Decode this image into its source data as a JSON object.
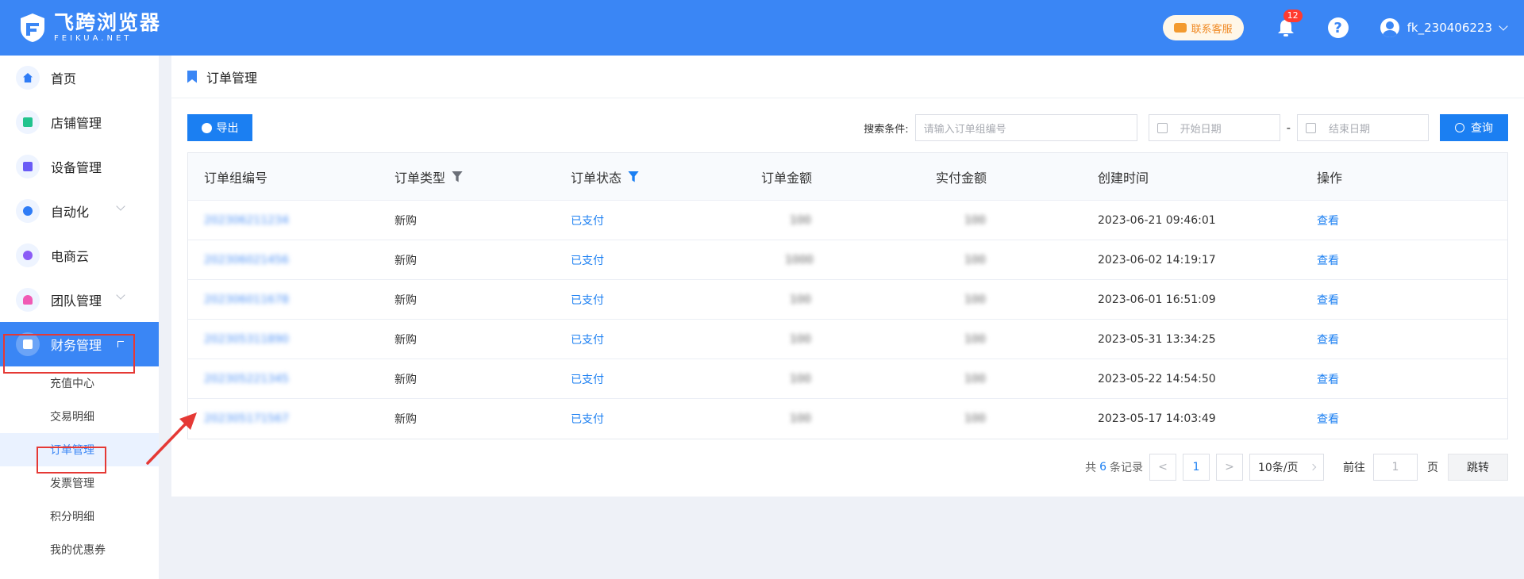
{
  "header": {
    "logo_name": "飞跨浏览器",
    "logo_sub": "FEIKUA.NET",
    "service_label": "联系客服",
    "notification_count": "12",
    "help_glyph": "?",
    "username": "fk_230406223"
  },
  "sidebar": {
    "items": [
      {
        "label": "首页",
        "icon": "home-icon",
        "color": "#2f7cf6"
      },
      {
        "label": "店铺管理",
        "icon": "store-icon",
        "color": "#22c38e"
      },
      {
        "label": "设备管理",
        "icon": "device-icon",
        "color": "#6a5cf6"
      },
      {
        "label": "自动化",
        "icon": "automation-icon",
        "color": "#2f7cf6"
      },
      {
        "label": "电商云",
        "icon": "cloud-icon",
        "color": "#8b5cf6"
      },
      {
        "label": "团队管理",
        "icon": "team-icon",
        "color": "#f05ab4"
      },
      {
        "label": "财务管理",
        "icon": "wallet-icon",
        "color": "#ffffff"
      }
    ],
    "sub_items": [
      "充值中心",
      "交易明细",
      "订单管理",
      "发票管理",
      "积分明细",
      "我的优惠券"
    ]
  },
  "page": {
    "breadcrumb": "订单管理",
    "export_label": "导出",
    "search_label": "搜索条件:",
    "order_placeholder": "请输入订单组编号",
    "start_date_placeholder": "开始日期",
    "end_date_placeholder": "结束日期",
    "date_separator": "-",
    "query_label": "查询"
  },
  "table": {
    "columns": [
      "订单组编号",
      "订单类型",
      "订单状态",
      "订单金额",
      "实付金额",
      "创建时间",
      "操作"
    ],
    "rows": [
      {
        "id": "202306211234",
        "type": "新购",
        "status": "已支付",
        "amount": "100",
        "paid": "100",
        "created": "2023-06-21 09:46:01",
        "action": "查看"
      },
      {
        "id": "202306021456",
        "type": "新购",
        "status": "已支付",
        "amount": "1000",
        "paid": "100",
        "created": "2023-06-02 14:19:17",
        "action": "查看"
      },
      {
        "id": "202306011678",
        "type": "新购",
        "status": "已支付",
        "amount": "100",
        "paid": "100",
        "created": "2023-06-01 16:51:09",
        "action": "查看"
      },
      {
        "id": "202305311890",
        "type": "新购",
        "status": "已支付",
        "amount": "100",
        "paid": "100",
        "created": "2023-05-31 13:34:25",
        "action": "查看"
      },
      {
        "id": "202305221345",
        "type": "新购",
        "status": "已支付",
        "amount": "100",
        "paid": "100",
        "created": "2023-05-22 14:54:50",
        "action": "查看"
      },
      {
        "id": "202305171567",
        "type": "新购",
        "status": "已支付",
        "amount": "100",
        "paid": "100",
        "created": "2023-05-17 14:03:49",
        "action": "查看"
      }
    ]
  },
  "pagination": {
    "total_prefix": "共",
    "total": "6",
    "total_suffix": "条记录",
    "prev": "<",
    "current": "1",
    "next": ">",
    "page_size": "10条/页",
    "goto_label": "前往",
    "goto_value": "1",
    "page_suffix": "页",
    "jump_label": "跳转"
  }
}
